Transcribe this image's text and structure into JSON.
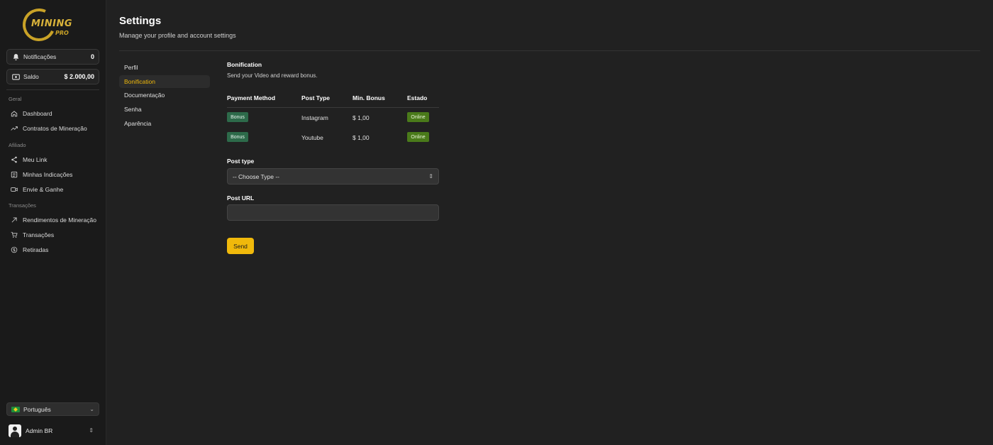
{
  "brand": {
    "name": "MINING",
    "sub": "PRO",
    "accent": "#f0b90b"
  },
  "sidebar": {
    "notifications": {
      "label": "Notificações",
      "value": "0"
    },
    "balance": {
      "label": "Saldo",
      "value": "$ 2.000,00"
    },
    "sections": [
      {
        "title": "Geral",
        "items": [
          {
            "label": "Dashboard",
            "icon": "home-icon"
          },
          {
            "label": "Contratos de Mineração",
            "icon": "trend-icon"
          }
        ]
      },
      {
        "title": "Afiliado",
        "items": [
          {
            "label": "Meu Link",
            "icon": "share-icon"
          },
          {
            "label": "Minhas Indicações",
            "icon": "users-icon"
          },
          {
            "label": "Envie & Ganhe",
            "icon": "video-icon"
          }
        ]
      },
      {
        "title": "Transações",
        "items": [
          {
            "label": "Rendimentos de Mineração",
            "icon": "arrow-up-right-icon"
          },
          {
            "label": "Transações",
            "icon": "cart-icon"
          },
          {
            "label": "Retiradas",
            "icon": "coin-icon"
          }
        ]
      }
    ],
    "language": "Português",
    "user": "Admin BR"
  },
  "header": {
    "title": "Settings",
    "subtitle": "Manage your profile and account settings"
  },
  "settings_nav": [
    "Perfil",
    "Bonification",
    "Documentação",
    "Senha",
    "Aparência"
  ],
  "settings_nav_active": "Bonification",
  "content": {
    "title": "Bonification",
    "subtitle": "Send your Video and reward bonus.",
    "table": {
      "headers": [
        "Payment Method",
        "Post Type",
        "Min. Bonus",
        "Estado"
      ],
      "rows": [
        {
          "method": "Bonus",
          "post_type": "Instagram",
          "min_bonus": "$ 1,00",
          "status": "Online"
        },
        {
          "method": "Bonus",
          "post_type": "Youtube",
          "min_bonus": "$ 1,00",
          "status": "Online"
        }
      ]
    },
    "post_type_label": "Post type",
    "post_type_value": "-- Choose Type --",
    "post_url_label": "Post URL",
    "post_url_value": "",
    "send_label": "Send"
  }
}
